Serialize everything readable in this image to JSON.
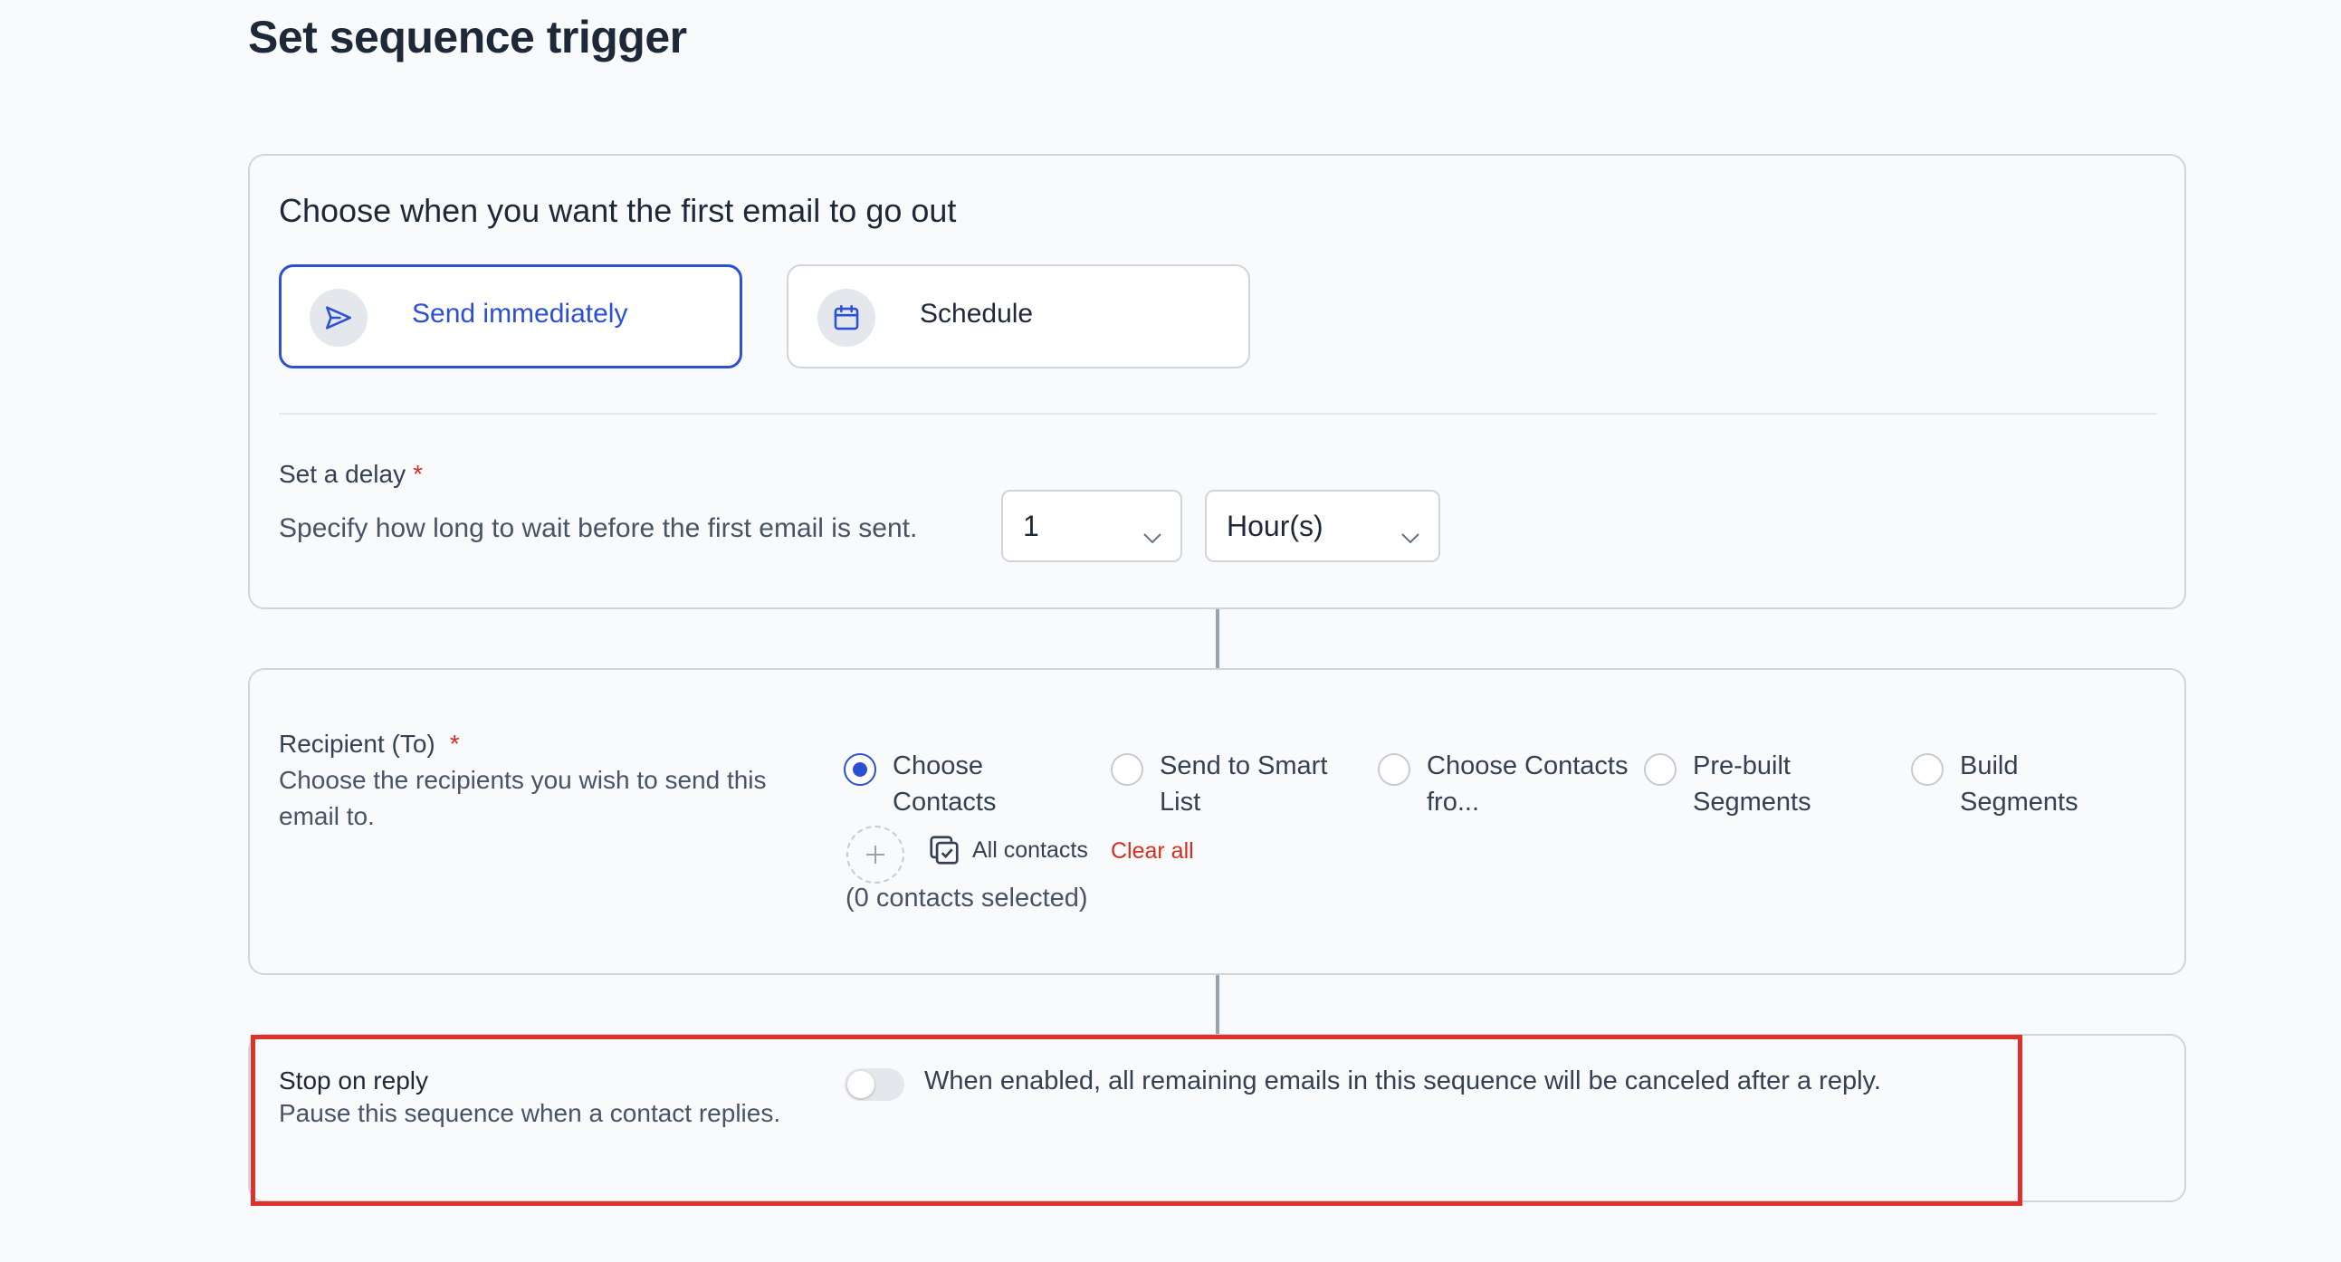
{
  "page": {
    "title": "Set sequence trigger"
  },
  "trigger": {
    "heading": "Choose when you want the first email to go out",
    "options": [
      {
        "label": "Send immediately",
        "icon": "send-icon",
        "selected": true
      },
      {
        "label": "Schedule",
        "icon": "calendar-icon",
        "selected": false
      }
    ],
    "delay": {
      "label": "Set a delay",
      "required_mark": "*",
      "help": "Specify how long to wait before the first email is sent.",
      "amount": "1",
      "unit": "Hour(s)"
    }
  },
  "recipient": {
    "label": "Recipient (To)",
    "required_mark": "*",
    "help": "Choose the recipients you wish to send this email to.",
    "options": [
      {
        "label": "Choose Contacts",
        "checked": true
      },
      {
        "label": "Send to Smart List",
        "checked": false
      },
      {
        "label": "Choose Contacts fro...",
        "checked": false
      },
      {
        "label": "Pre-built Segments",
        "checked": false
      },
      {
        "label": "Build Segments",
        "checked": false
      }
    ],
    "all_contacts_label": "All contacts",
    "clear_all_label": "Clear all",
    "count_text": "(0 contacts selected)"
  },
  "stop_on_reply": {
    "label": "Stop on reply",
    "help": "Pause this sequence when a contact replies.",
    "enabled": false,
    "description": "When enabled, all remaining emails in this sequence will be canceled after a reply."
  },
  "colors": {
    "accent": "#2c4fd8",
    "required": "#d92d20",
    "highlight": "#e0302a"
  }
}
